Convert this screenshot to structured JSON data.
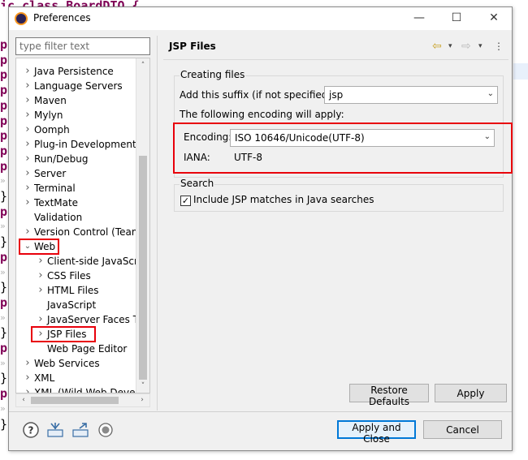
{
  "background": {
    "title_fragment": "ic class BoardDTO {",
    "lines": [
      {
        "text": "p",
        "kind": "kw"
      },
      {
        "text": "p",
        "kind": "kw"
      },
      {
        "text": "p",
        "kind": "kw"
      },
      {
        "text": "p",
        "kind": "kw"
      },
      {
        "text": "p",
        "kind": "kw"
      },
      {
        "text": "p",
        "kind": "kw"
      },
      {
        "text": "p",
        "kind": "kw"
      },
      {
        "text": "p",
        "kind": "kw"
      },
      {
        "text": "p",
        "kind": "kw"
      },
      {
        "text": "»",
        "kind": "arrow"
      },
      {
        "text": "}",
        "kind": "brace"
      },
      {
        "text": "p",
        "kind": "kw"
      },
      {
        "text": "»",
        "kind": "arrow"
      },
      {
        "text": "}",
        "kind": "brace"
      },
      {
        "text": "p",
        "kind": "kw"
      },
      {
        "text": "»",
        "kind": "arrow"
      },
      {
        "text": "}",
        "kind": "brace"
      },
      {
        "text": "p",
        "kind": "kw"
      },
      {
        "text": "»",
        "kind": "arrow"
      },
      {
        "text": "}",
        "kind": "brace"
      },
      {
        "text": "p",
        "kind": "kw"
      },
      {
        "text": "»",
        "kind": "arrow"
      },
      {
        "text": "}",
        "kind": "brace"
      },
      {
        "text": "p",
        "kind": "kw"
      },
      {
        "text": "»",
        "kind": "arrow"
      },
      {
        "text": "}",
        "kind": "brace"
      }
    ]
  },
  "window": {
    "title": "Preferences",
    "minimize": "—",
    "maximize": "☐",
    "close": "✕"
  },
  "filter": {
    "placeholder": "type filter text"
  },
  "tree": {
    "items": [
      {
        "label": "Java Persistence",
        "level": 0,
        "chevron": "›"
      },
      {
        "label": "Language Servers",
        "level": 0,
        "chevron": "›"
      },
      {
        "label": "Maven",
        "level": 0,
        "chevron": "›"
      },
      {
        "label": "Mylyn",
        "level": 0,
        "chevron": "›"
      },
      {
        "label": "Oomph",
        "level": 0,
        "chevron": "›"
      },
      {
        "label": "Plug-in Development",
        "level": 0,
        "chevron": "›"
      },
      {
        "label": "Run/Debug",
        "level": 0,
        "chevron": "›"
      },
      {
        "label": "Server",
        "level": 0,
        "chevron": "›"
      },
      {
        "label": "Terminal",
        "level": 0,
        "chevron": "›"
      },
      {
        "label": "TextMate",
        "level": 0,
        "chevron": "›"
      },
      {
        "label": "Validation",
        "level": 0,
        "chevron": ""
      },
      {
        "label": "Version Control (Team)",
        "level": 0,
        "chevron": "›"
      },
      {
        "label": "Web",
        "level": 0,
        "chevron": "⌄"
      },
      {
        "label": "Client-side JavaScript",
        "level": 1,
        "chevron": "›"
      },
      {
        "label": "CSS Files",
        "level": 1,
        "chevron": "›"
      },
      {
        "label": "HTML Files",
        "level": 1,
        "chevron": "›"
      },
      {
        "label": "JavaScript",
        "level": 1,
        "chevron": ""
      },
      {
        "label": "JavaServer Faces Tools",
        "level": 1,
        "chevron": "›"
      },
      {
        "label": "JSP Files",
        "level": 1,
        "chevron": "›"
      },
      {
        "label": "Web Page Editor",
        "level": 1,
        "chevron": ""
      },
      {
        "label": "Web Services",
        "level": 0,
        "chevron": "›"
      },
      {
        "label": "XML",
        "level": 0,
        "chevron": "›"
      },
      {
        "label": "XML (Wild Web Developer)",
        "level": 0,
        "chevron": "›"
      }
    ],
    "scroll_up": "˄",
    "scroll_down": "˅",
    "scroll_left": "‹",
    "scroll_right": "›"
  },
  "page": {
    "title": "JSP Files",
    "back_icon": "⇦",
    "forward_icon": "⇨",
    "dropdown_icon": "▾",
    "menu_icon": "⋮",
    "creating_files": {
      "group_label": "Creating files",
      "suffix_label": "Add this suffix (if not specified):",
      "suffix_value": "jsp",
      "encoding_note": "The following encoding will apply:",
      "encoding_label": "Encoding:",
      "encoding_value": "ISO 10646/Unicode(UTF-8)",
      "iana_label": "IANA:",
      "iana_value": "UTF-8"
    },
    "search": {
      "group_label": "Search",
      "checkbox_label": "Include JSP matches in Java searches",
      "checked": true,
      "check_mark": "✓"
    },
    "combo_arrow": "⌄",
    "restore_defaults": "Restore Defaults",
    "apply": "Apply"
  },
  "footer": {
    "help_icon": "?",
    "apply_and_close": "Apply and Close",
    "cancel": "Cancel"
  },
  "colors": {
    "highlight_red": "#e8000b",
    "default_button_border": "#0078d7",
    "keyword": "#7f0055"
  }
}
